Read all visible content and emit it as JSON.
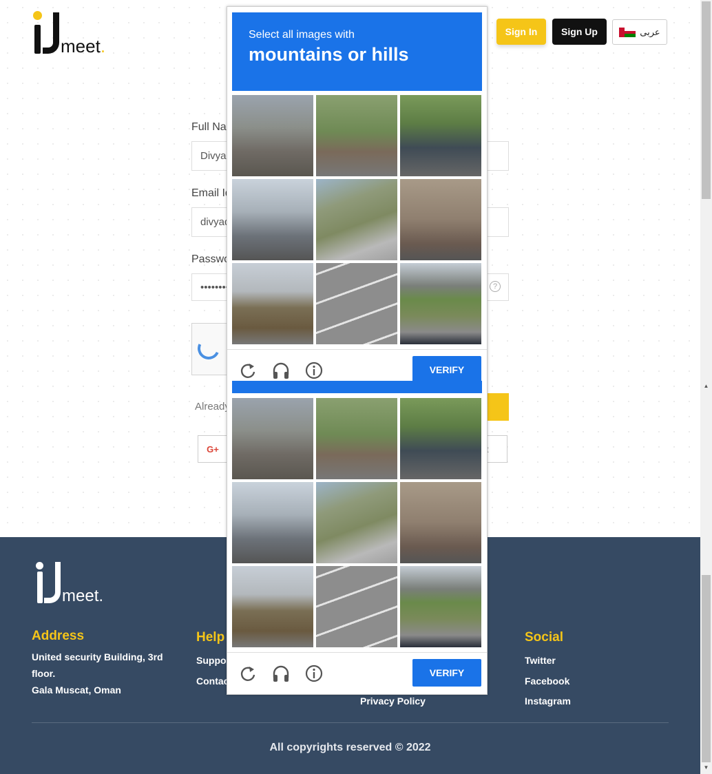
{
  "header": {
    "logo_text": "meet",
    "logo_dot": ".",
    "signin_label": "Sign In",
    "signup_label": "Sign Up",
    "lang_label": "عربى"
  },
  "form": {
    "fullname_label": "Full Na",
    "fullname_value": "Divya",
    "email_label": "Email Id",
    "email_value": "divyad",
    "password_label": "Passwo",
    "password_value": "••••••••",
    "help_glyph": "?",
    "already_text": "Already",
    "gplus_label": "G+",
    "right_fragment": "t"
  },
  "captcha": {
    "instruction_small": "Select all images with",
    "instruction_big": "mountains or hills",
    "verify_label": "VERIFY",
    "icons": [
      "reload-icon",
      "headphones-icon",
      "info-icon"
    ]
  },
  "footer": {
    "logo_text": "meet",
    "logo_dot": ".",
    "address_heading": "Address",
    "address_line1": "United security Building, 3rd",
    "address_line2": "floor.",
    "address_line3": "Gala Muscat, Oman",
    "help_heading": "Help",
    "help_links": [
      "Suppor",
      "Contac"
    ],
    "privacy_link": "Privacy Policy",
    "social_heading": "Social",
    "social_links": [
      "Twitter",
      "Facebook",
      "Instagram"
    ],
    "copyright": "All copyrights reserved © 2022"
  },
  "colors": {
    "brand_yellow": "#f5c518",
    "captcha_blue": "#1a73e8",
    "footer_bg": "#364a63"
  }
}
